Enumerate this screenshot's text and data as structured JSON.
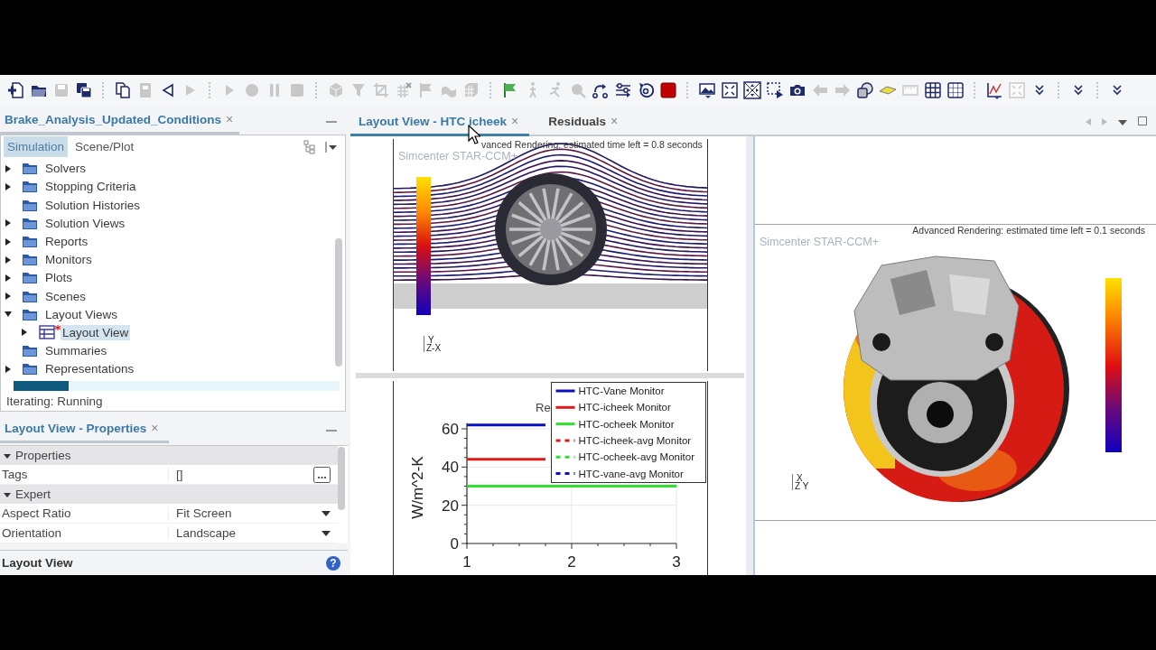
{
  "toolbar": [
    {
      "kind": "new",
      "disabled": false
    },
    {
      "kind": "open",
      "disabled": false
    },
    {
      "kind": "save",
      "disabled": true
    },
    {
      "kind": "save-all",
      "disabled": false
    },
    {
      "kind": "separator"
    },
    {
      "kind": "copy",
      "disabled": false
    },
    {
      "kind": "paste",
      "disabled": true
    },
    {
      "kind": "back",
      "disabled": false
    },
    {
      "kind": "forward",
      "disabled": true
    },
    {
      "kind": "separator"
    },
    {
      "kind": "play",
      "disabled": true
    },
    {
      "kind": "record",
      "disabled": true
    },
    {
      "kind": "pause",
      "disabled": true
    },
    {
      "kind": "stop",
      "disabled": true
    },
    {
      "kind": "separator"
    },
    {
      "kind": "cube",
      "disabled": true
    },
    {
      "kind": "funnel",
      "disabled": true
    },
    {
      "kind": "crop",
      "disabled": true
    },
    {
      "kind": "grid-x",
      "disabled": true
    },
    {
      "kind": "flag",
      "disabled": true
    },
    {
      "kind": "surface",
      "disabled": true
    },
    {
      "kind": "mesh",
      "disabled": true
    },
    {
      "kind": "separator"
    },
    {
      "kind": "start-flag",
      "disabled": false
    },
    {
      "kind": "walk",
      "disabled": true
    },
    {
      "kind": "run",
      "disabled": true
    },
    {
      "kind": "zoom",
      "disabled": true
    },
    {
      "kind": "steps",
      "disabled": false
    },
    {
      "kind": "sliders",
      "disabled": false
    },
    {
      "kind": "reset",
      "disabled": false
    },
    {
      "kind": "stop-button",
      "disabled": false
    },
    {
      "kind": "separator"
    },
    {
      "kind": "image",
      "disabled": false
    },
    {
      "kind": "fit",
      "disabled": false
    },
    {
      "kind": "x-box",
      "disabled": false
    },
    {
      "kind": "select",
      "disabled": false
    },
    {
      "kind": "camera",
      "disabled": false
    },
    {
      "kind": "arrow-left",
      "disabled": true
    },
    {
      "kind": "arrow-right",
      "disabled": true
    },
    {
      "kind": "circles",
      "disabled": false
    },
    {
      "kind": "diamond",
      "disabled": false
    },
    {
      "kind": "ruler",
      "disabled": true
    },
    {
      "kind": "grid",
      "disabled": false
    },
    {
      "kind": "grid-light",
      "disabled": false
    },
    {
      "kind": "separator"
    },
    {
      "kind": "chart",
      "disabled": false
    },
    {
      "kind": "fit",
      "disabled": true
    },
    {
      "kind": "more",
      "disabled": false
    },
    {
      "kind": "separator"
    },
    {
      "kind": "more",
      "disabled": false
    },
    {
      "kind": "separator"
    },
    {
      "kind": "more",
      "disabled": false
    }
  ],
  "simulation_panel": {
    "tab": {
      "label": "Brake_Analysis_Updated_Conditions",
      "close": "×"
    },
    "subtabs": [
      {
        "label": "Simulation",
        "selected": true
      },
      {
        "label": "Scene/Plot",
        "selected": false
      }
    ],
    "tree": [
      {
        "label": "Solvers",
        "kind": "folder",
        "expandable": true,
        "expanded": false,
        "selected": false,
        "modified": false
      },
      {
        "label": "Stopping Criteria",
        "kind": "folder",
        "expandable": true,
        "expanded": false,
        "selected": false,
        "modified": false
      },
      {
        "label": "Solution Histories",
        "kind": "folder",
        "expandable": false,
        "selected": false,
        "modified": false
      },
      {
        "label": "Solution Views",
        "kind": "folder",
        "expandable": true,
        "expanded": false,
        "selected": false,
        "modified": false
      },
      {
        "label": "Reports",
        "kind": "folder",
        "expandable": true,
        "expanded": false,
        "selected": false,
        "modified": false
      },
      {
        "label": "Monitors",
        "kind": "folder",
        "expandable": true,
        "expanded": false,
        "selected": false,
        "modified": false
      },
      {
        "label": "Plots",
        "kind": "folder",
        "expandable": true,
        "expanded": false,
        "selected": false,
        "modified": false
      },
      {
        "label": "Scenes",
        "kind": "folder",
        "expandable": true,
        "expanded": false,
        "selected": false,
        "modified": false
      },
      {
        "label": "Layout Views",
        "kind": "folder",
        "expandable": true,
        "expanded": true,
        "selected": false,
        "modified": false,
        "children": [
          {
            "label": "Layout View",
            "kind": "layout-view",
            "expandable": true,
            "expanded": false,
            "selected": true,
            "modified": true
          }
        ]
      },
      {
        "label": "Summaries",
        "kind": "folder",
        "expandable": false,
        "selected": false,
        "modified": false
      },
      {
        "label": "Representations",
        "kind": "folder",
        "expandable": true,
        "expanded": false,
        "selected": false,
        "modified": false
      }
    ],
    "progress": {
      "level": 0.17,
      "status": "Iterating: Running"
    }
  },
  "properties_panel": {
    "tab": {
      "label": "Layout View - Properties",
      "close": "×"
    },
    "rows": [
      {
        "kind": "group",
        "label": "Properties",
        "expanded": true
      },
      {
        "kind": "ellipsis-property",
        "name": "Tags",
        "value": "[]"
      },
      {
        "kind": "group",
        "label": "Expert",
        "expanded": true
      },
      {
        "kind": "dropdown-property",
        "name": "Aspect Ratio",
        "value": "Fit Screen"
      },
      {
        "kind": "dropdown-property",
        "name": "Orientation",
        "value": "Landscape"
      }
    ],
    "footer": {
      "title": "Layout View",
      "help": "?"
    }
  },
  "editor_tabs": [
    {
      "label": "Layout View - HTC icheek",
      "selected": true,
      "close": "×"
    },
    {
      "label": "Residuals",
      "selected": false,
      "close": "×"
    }
  ],
  "streamline_view": {
    "watermark": "Simcenter STAR-CCM+",
    "status": "vanced Rendering: estimated time left = 0.8 seconds",
    "axis_up": "Y",
    "axis_side": "Z-X"
  },
  "monitor_plot": {
    "chart_data": {
      "type": "line",
      "title": "Re",
      "ylabel": "W/m^2-K",
      "x": [
        1,
        1.75,
        3
      ],
      "xlim": [
        1,
        3
      ],
      "ylim": [
        0,
        63
      ],
      "xticks": [
        1,
        2,
        3
      ],
      "yticks": [
        0,
        20,
        40,
        60
      ],
      "grid": true,
      "legend": "upper right",
      "series": [
        {
          "name": "HTC-Vane Monitor",
          "color": "#0a10c0",
          "line_style": "solid",
          "values": [
            62,
            62,
            null
          ]
        },
        {
          "name": "HTC-icheek Monitor",
          "color": "#e01818",
          "line_style": "solid",
          "values": [
            44,
            44,
            null
          ]
        },
        {
          "name": "HTC-ocheek Monitor",
          "color": "#30e030",
          "line_style": "solid",
          "values": [
            30,
            30,
            30
          ]
        },
        {
          "name": "HTC-icheek-avg Monitor",
          "color": "#e01818",
          "line_style": "dashed",
          "values": [
            null,
            null,
            null
          ]
        },
        {
          "name": "HTC-ocheek-avg Monitor",
          "color": "#30e030",
          "line_style": "dashed",
          "values": [
            null,
            null,
            null
          ]
        },
        {
          "name": "HTC-vane-avg Monitor",
          "color": "#0a10c0",
          "line_style": "dashed",
          "values": [
            null,
            null,
            null
          ]
        }
      ]
    }
  },
  "brake_view": {
    "watermark": "Simcenter STAR-CCM+",
    "status": "Advanced Rendering: estimated time left = 0.1 seconds",
    "axis_up": "X",
    "axis_side": "Z Y"
  }
}
